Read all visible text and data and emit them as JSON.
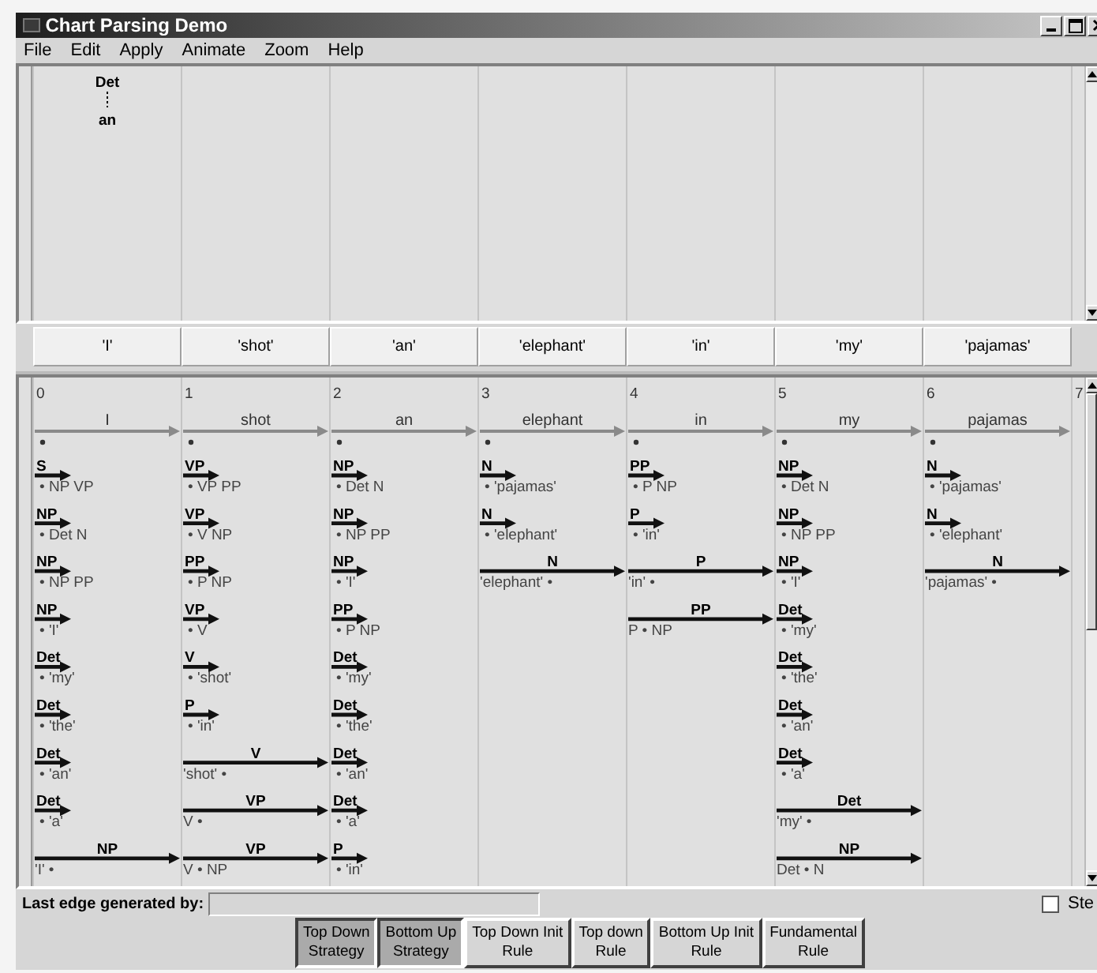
{
  "window": {
    "title": "Chart Parsing Demo"
  },
  "menu": [
    "File",
    "Edit",
    "Apply",
    "Animate",
    "Zoom",
    "Help"
  ],
  "tree": {
    "label": "Det",
    "children": [
      {
        "label": "an"
      }
    ]
  },
  "tokens": [
    "'I'",
    "'shot'",
    "'an'",
    "'elephant'",
    "'in'",
    "'my'",
    "'pajamas'"
  ],
  "chart": {
    "positions": [
      {
        "number": "0",
        "word": "I"
      },
      {
        "number": "1",
        "word": "shot"
      },
      {
        "number": "2",
        "word": "an"
      },
      {
        "number": "3",
        "word": "elephant"
      },
      {
        "number": "4",
        "word": "in"
      },
      {
        "number": "5",
        "word": "my"
      },
      {
        "number": "6",
        "word": "pajamas"
      },
      {
        "number": "7"
      }
    ],
    "columns": [
      [
        {
          "kind": "predicted",
          "label": "S",
          "rule": "• NP VP"
        },
        {
          "kind": "predicted",
          "label": "NP",
          "rule": "• Det N"
        },
        {
          "kind": "predicted",
          "label": "NP",
          "rule": "• NP PP"
        },
        {
          "kind": "predicted",
          "label": "NP",
          "rule": "• 'I'"
        },
        {
          "kind": "predicted",
          "label": "Det",
          "rule": "• 'my'"
        },
        {
          "kind": "predicted",
          "label": "Det",
          "rule": "• 'the'"
        },
        {
          "kind": "predicted",
          "label": "Det",
          "rule": "• 'an'"
        },
        {
          "kind": "predicted",
          "label": "Det",
          "rule": "• 'a'"
        },
        {
          "kind": "span",
          "label": "NP",
          "rule": "'I' •"
        }
      ],
      [
        {
          "kind": "predicted",
          "label": "VP",
          "rule": "• VP PP"
        },
        {
          "kind": "predicted",
          "label": "VP",
          "rule": "• V NP"
        },
        {
          "kind": "predicted",
          "label": "PP",
          "rule": "• P NP"
        },
        {
          "kind": "predicted",
          "label": "VP",
          "rule": "• V"
        },
        {
          "kind": "predicted",
          "label": "V",
          "rule": "• 'shot'"
        },
        {
          "kind": "predicted",
          "label": "P",
          "rule": "• 'in'"
        },
        {
          "kind": "span",
          "label": "V",
          "rule": "'shot' •"
        },
        {
          "kind": "span",
          "label": "VP",
          "rule": "V •"
        },
        {
          "kind": "span",
          "label": "VP",
          "rule": "V • NP"
        }
      ],
      [
        {
          "kind": "predicted",
          "label": "NP",
          "rule": "• Det N"
        },
        {
          "kind": "predicted",
          "label": "NP",
          "rule": "• NP PP"
        },
        {
          "kind": "predicted",
          "label": "NP",
          "rule": "• 'I'"
        },
        {
          "kind": "predicted",
          "label": "PP",
          "rule": "• P NP"
        },
        {
          "kind": "predicted",
          "label": "Det",
          "rule": "• 'my'"
        },
        {
          "kind": "predicted",
          "label": "Det",
          "rule": "• 'the'"
        },
        {
          "kind": "predicted",
          "label": "Det",
          "rule": "• 'an'"
        },
        {
          "kind": "predicted",
          "label": "Det",
          "rule": "• 'a'"
        },
        {
          "kind": "predicted",
          "label": "P",
          "rule": "• 'in'"
        }
      ],
      [
        {
          "kind": "predicted",
          "label": "N",
          "rule": "• 'pajamas'"
        },
        {
          "kind": "predicted",
          "label": "N",
          "rule": "• 'elephant'"
        },
        {
          "kind": "span",
          "label": "N",
          "rule": "'elephant' •"
        }
      ],
      [
        {
          "kind": "predicted",
          "label": "PP",
          "rule": "• P NP"
        },
        {
          "kind": "predicted",
          "label": "P",
          "rule": "• 'in'"
        },
        {
          "kind": "span",
          "label": "P",
          "rule": "'in' •"
        },
        {
          "kind": "span",
          "label": "PP",
          "rule": "P • NP"
        }
      ],
      [
        {
          "kind": "predicted",
          "label": "NP",
          "rule": "• Det N"
        },
        {
          "kind": "predicted",
          "label": "NP",
          "rule": "• NP PP"
        },
        {
          "kind": "predicted",
          "label": "NP",
          "rule": "• 'I'"
        },
        {
          "kind": "predicted",
          "label": "Det",
          "rule": "• 'my'"
        },
        {
          "kind": "predicted",
          "label": "Det",
          "rule": "• 'the'"
        },
        {
          "kind": "predicted",
          "label": "Det",
          "rule": "• 'an'"
        },
        {
          "kind": "predicted",
          "label": "Det",
          "rule": "• 'a'"
        },
        {
          "kind": "span",
          "label": "Det",
          "rule": "'my' •"
        },
        {
          "kind": "span",
          "label": "NP",
          "rule": "Det • N"
        }
      ],
      [
        {
          "kind": "predicted",
          "label": "N",
          "rule": "• 'pajamas'"
        },
        {
          "kind": "predicted",
          "label": "N",
          "rule": "• 'elephant'"
        },
        {
          "kind": "span",
          "label": "N",
          "rule": "'pajamas' •"
        }
      ]
    ]
  },
  "status": {
    "label": "Last edge generated by:"
  },
  "step": {
    "label": "Ste",
    "checked": false
  },
  "buttons": [
    {
      "lines": [
        "Top Down",
        "Strategy"
      ],
      "selected": true
    },
    {
      "lines": [
        "Bottom Up",
        "Strategy"
      ],
      "selected": true
    },
    {
      "lines": [
        "Top Down Init",
        "Rule"
      ],
      "selected": false
    },
    {
      "lines": [
        "Top down",
        "Rule"
      ],
      "selected": false
    },
    {
      "lines": [
        "Bottom Up Init",
        "Rule"
      ],
      "selected": false
    },
    {
      "lines": [
        "Fundamental",
        "Rule"
      ],
      "selected": false
    }
  ]
}
